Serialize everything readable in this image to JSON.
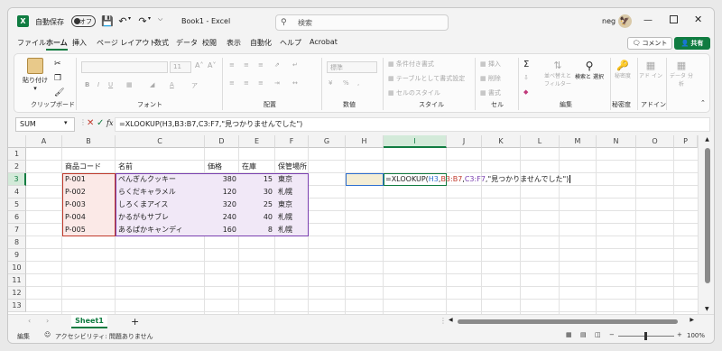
{
  "title": {
    "autosave_label": "自動保存",
    "autosave_state": "オフ",
    "doc_title": "Book1 - Excel",
    "search_placeholder": "検索",
    "user": "neg"
  },
  "tabs": [
    "ファイル",
    "ホーム",
    "挿入",
    "ページ レイアウト",
    "数式",
    "データ",
    "校閲",
    "表示",
    "自動化",
    "ヘルプ",
    "Acrobat"
  ],
  "comment_label": "コメント",
  "share_label": "共有",
  "ribbon": {
    "paste": "貼り付け",
    "clipboard": "クリップボード",
    "font_size": "11",
    "font": "フォント",
    "alignment": "配置",
    "number_format": "標準",
    "number": "数値",
    "cond_format": "条件付き書式",
    "table_format": "テーブルとして書式設定",
    "cell_style": "セルのスタイル",
    "style": "スタイル",
    "insert": "挿入",
    "delete": "削除",
    "format": "書式",
    "cells": "セル",
    "sort_filter": "並べ替えと フィルター",
    "find_select": "検索と 選択",
    "editing": "編集",
    "sensitivity": "秘密度",
    "sensitivity_group": "秘密度",
    "addin": "アド イン",
    "addin_group": "アドイン",
    "analyze": "データ 分析"
  },
  "namebox": "SUM",
  "formula": "=XLOOKUP(H3,B3:B7,C3:F7,\"見つかりませんでした\")",
  "columns": [
    "A",
    "B",
    "C",
    "D",
    "E",
    "F",
    "G",
    "H",
    "I",
    "J",
    "K",
    "L",
    "M",
    "N",
    "O",
    "P"
  ],
  "rows": [
    "1",
    "2",
    "3",
    "4",
    "5",
    "6",
    "7",
    "8",
    "9",
    "10",
    "11",
    "12",
    "13"
  ],
  "table": {
    "headers": [
      "商品コード",
      "名前",
      "価格",
      "在庫",
      "保管場所"
    ],
    "rows": [
      [
        "P-001",
        "ぺんぎんクッキー",
        "380",
        "15",
        "東京"
      ],
      [
        "P-002",
        "らくだキャラメル",
        "120",
        "30",
        "札幌"
      ],
      [
        "P-003",
        "しろくまアイス",
        "320",
        "25",
        "東京"
      ],
      [
        "P-004",
        "かるがもサブレ",
        "240",
        "40",
        "札幌"
      ],
      [
        "P-005",
        "あるぱかキャンディ",
        "160",
        "8",
        "札幌"
      ]
    ]
  },
  "edit_cell": {
    "prefix": "=XLOOKUP(",
    "a1": "H3",
    "a2": "B3:B7",
    "a3": "C3:F7",
    "rest": ",\"見つかりませんでした\")"
  },
  "sheet_tab": "Sheet1",
  "status": {
    "mode": "編集",
    "accessibility": "アクセシビリティ: 問題ありません",
    "zoom": "100%"
  },
  "colors": {
    "accent": "#107c41",
    "ref_blue": "#2e6fd0",
    "ref_red": "#c0392b",
    "ref_purple": "#7a3fb0"
  }
}
